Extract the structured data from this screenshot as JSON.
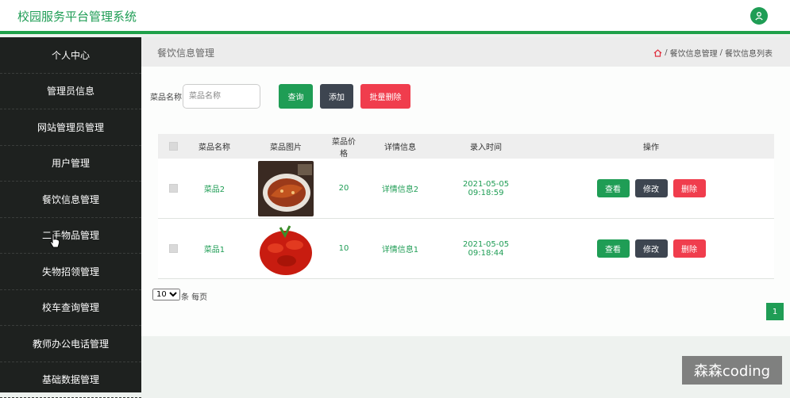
{
  "app": {
    "title": "校园服务平台管理系统"
  },
  "sidebar": {
    "items": [
      {
        "label": "个人中心"
      },
      {
        "label": "管理员信息"
      },
      {
        "label": "网站管理员管理"
      },
      {
        "label": "用户管理"
      },
      {
        "label": "餐饮信息管理"
      },
      {
        "label": "二手物品管理"
      },
      {
        "label": "失物招领管理"
      },
      {
        "label": "校车查询管理"
      },
      {
        "label": "教师办公电话管理"
      },
      {
        "label": "基础数据管理"
      }
    ]
  },
  "header": {
    "page_title": "餐饮信息管理",
    "breadcrumb": [
      "餐饮信息管理",
      "餐饮信息列表"
    ],
    "separator": "/"
  },
  "search": {
    "label": "菜品名称",
    "placeholder": "菜品名称",
    "value": "",
    "search_button": "查询",
    "add_button": "添加",
    "batch_delete_button": "批量删除"
  },
  "table": {
    "columns": [
      "菜品名称",
      "菜品图片",
      "菜品价格",
      "详情信息",
      "录入时间",
      "操作"
    ],
    "rows": [
      {
        "name": "菜品2",
        "image": "braised-fish",
        "price": "20",
        "detail": "详情信息2",
        "time": "2021-05-05 09:18:59"
      },
      {
        "name": "菜品1",
        "image": "crayfish",
        "price": "10",
        "detail": "详情信息1",
        "time": "2021-05-05 09:18:44"
      }
    ],
    "actions": {
      "view": "查看",
      "edit": "修改",
      "delete": "删除"
    }
  },
  "pagination": {
    "page_size": "10",
    "page_size_options": [
      "10"
    ],
    "per_page_label": "条 每页",
    "current_page": "1"
  },
  "watermark": "森森coding",
  "colors": {
    "accent": "#1f9d55",
    "danger": "#f03d4d",
    "dark": "#3d4550",
    "sidebar_bg": "#1e211f"
  }
}
